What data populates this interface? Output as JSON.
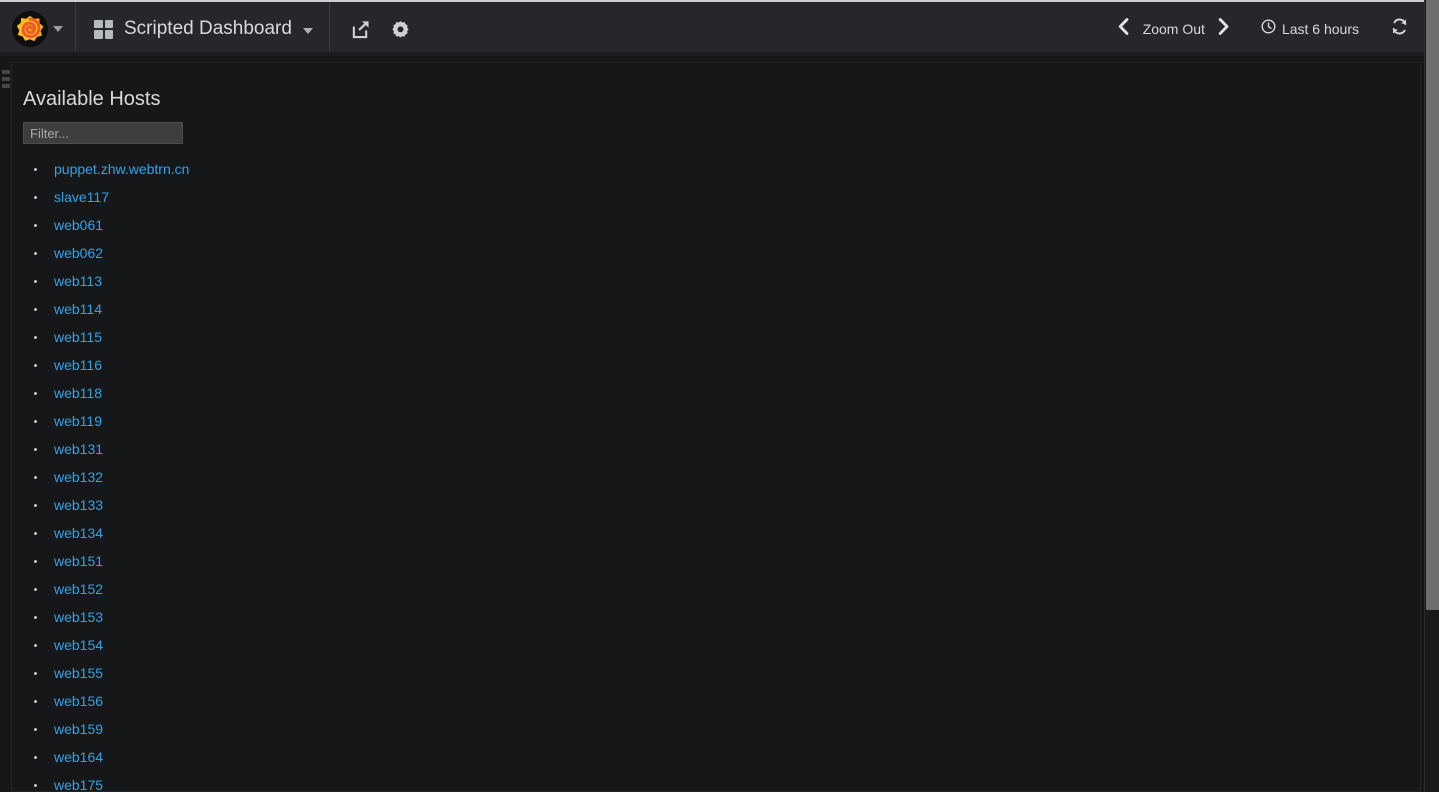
{
  "navbar": {
    "logo_icon": "grafana-logo-icon",
    "logo_caret_icon": "caret-down-icon",
    "dashboard_icon": "dashboard-grid-icon",
    "dashboard_title": "Scripted Dashboard",
    "dashboard_caret_icon": "caret-down-icon",
    "share_icon": "share-export-icon",
    "share_label": "Share dashboard",
    "settings_icon": "gear-icon",
    "settings_label": "Dashboard settings",
    "time": {
      "prev_icon": "chevron-left-icon",
      "zoom_out_label": "Zoom Out",
      "next_icon": "chevron-right-icon",
      "clock_icon": "clock-icon",
      "range_label": "Last 6 hours",
      "refresh_icon": "refresh-icon"
    }
  },
  "panel": {
    "drag_handle_icon": "drag-handle-icon",
    "heading": "Available Hosts",
    "filter": {
      "placeholder": "Filter...",
      "value": ""
    },
    "hosts": [
      "puppet.zhw.webtrn.cn",
      "slave117",
      "web061",
      "web062",
      "web113",
      "web114",
      "web115",
      "web116",
      "web118",
      "web119",
      "web131",
      "web132",
      "web133",
      "web134",
      "web151",
      "web152",
      "web153",
      "web154",
      "web155",
      "web156",
      "web159",
      "web164",
      "web175"
    ]
  },
  "scrollbar": {
    "name": "page-vertical-scrollbar"
  },
  "colors": {
    "nav_bg": "#26272b",
    "page_bg": "#161719",
    "link_blue": "#33a2e5",
    "text_light": "#d8d9da",
    "logo_orange": "#f05a28",
    "logo_yellow": "#fbbb1f"
  }
}
